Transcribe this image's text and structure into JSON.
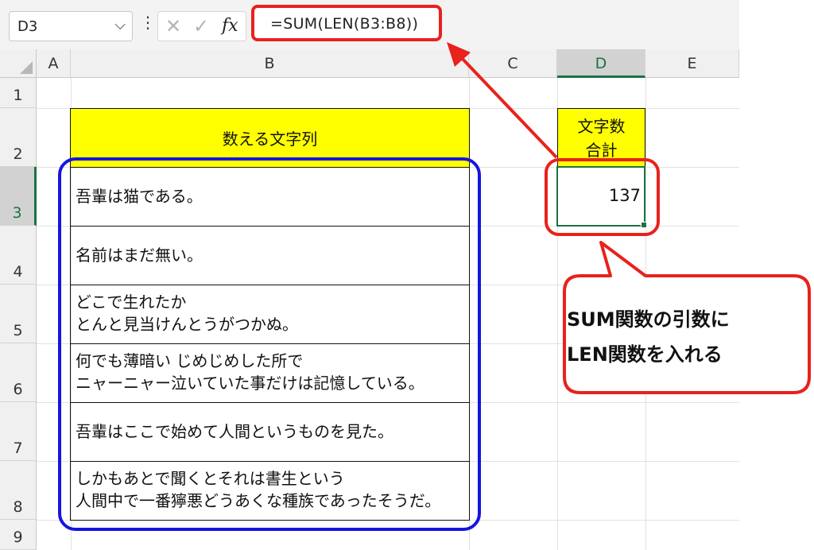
{
  "formula_bar": {
    "name_box": "D3",
    "formula": "=SUM(LEN(B3:B8))",
    "fx_label": "fx",
    "cancel_glyph": "✕",
    "enter_glyph": "✓"
  },
  "columns": [
    "A",
    "B",
    "C",
    "D",
    "E"
  ],
  "rows": [
    "1",
    "2",
    "3",
    "4",
    "5",
    "6",
    "7",
    "8",
    "9"
  ],
  "selected_cell": {
    "column": "D",
    "row": "3"
  },
  "cells": {
    "B2": "数える文字列",
    "D2": [
      "文字数",
      "合計"
    ],
    "D3": "137",
    "B3": [
      "吾輩は猫である。"
    ],
    "B4": [
      "名前はまだ無い。"
    ],
    "B5": [
      "どこで生れたか",
      "とんと見当けんとうがつかぬ。"
    ],
    "B6": [
      "何でも薄暗い じめじめした所で",
      "ニャーニャー泣いていた事だけは記憶している。"
    ],
    "B7": [
      "吾輩はここで始めて人間というものを見た。"
    ],
    "B8": [
      "しかもあとで聞くとそれは書生という",
      "人間中で一番獰悪どうあくな種族であったそうだ。"
    ]
  },
  "callout": {
    "lines": [
      "SUM関数の引数に",
      "LEN関数を入れる"
    ]
  },
  "colors": {
    "header_fill": "#ffff00",
    "annotation_red": "#e8221c",
    "annotation_blue": "#1515e0",
    "selection_green": "#1e7145"
  }
}
